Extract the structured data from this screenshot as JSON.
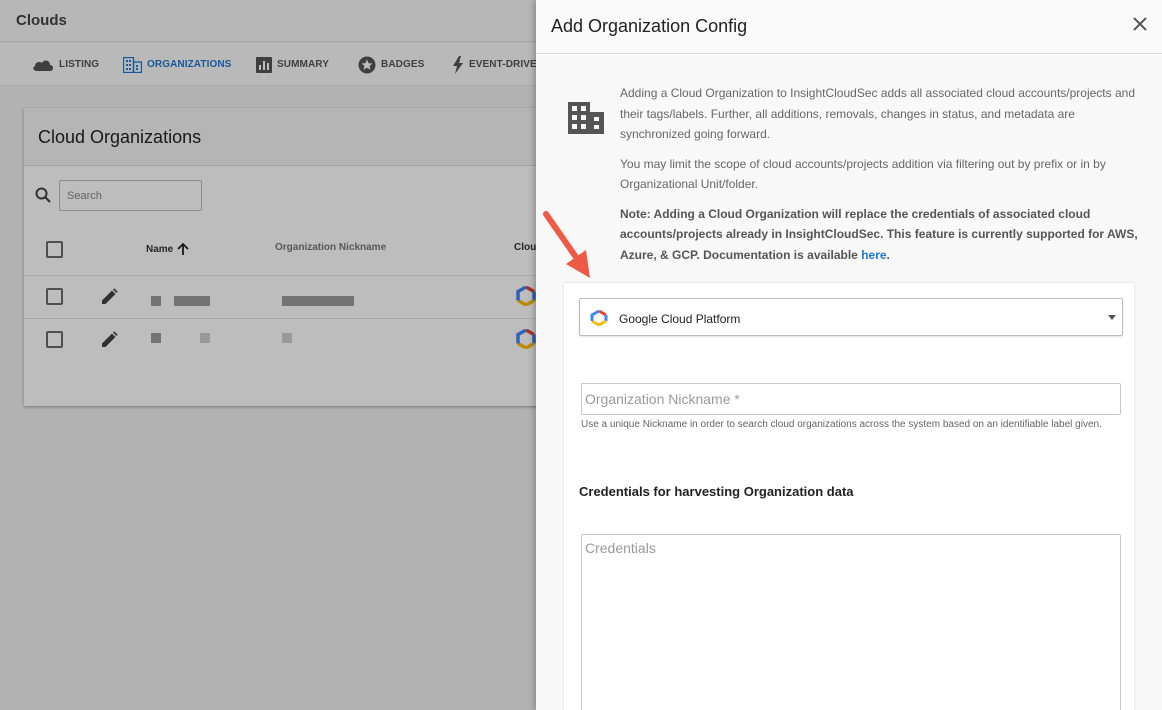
{
  "app": {
    "title": "Clouds"
  },
  "tabs": [
    {
      "label": "LISTING",
      "icon": "cloud-icon"
    },
    {
      "label": "ORGANIZATIONS",
      "icon": "building-icon",
      "active": true
    },
    {
      "label": "SUMMARY",
      "icon": "bar-chart-icon"
    },
    {
      "label": "BADGES",
      "icon": "star-badge-icon"
    },
    {
      "label": "EVENT-DRIVE",
      "icon": "lightning-icon"
    }
  ],
  "card": {
    "title": "Cloud Organizations",
    "search_placeholder": "Search",
    "columns": {
      "name": "Name",
      "nickname": "Organization Nickname",
      "cloud": "Clou"
    },
    "rows": [
      {
        "name_redacted": true,
        "nickname_redacted": true,
        "cloud_icon": "gcp-icon"
      },
      {
        "name_redacted": true,
        "nickname_redacted": true,
        "cloud_icon": "gcp-icon"
      }
    ]
  },
  "drawer": {
    "title": "Add Organization Config",
    "info_p1": "Adding a Cloud Organization to InsightCloudSec adds all associated cloud accounts/projects and their tags/labels. Further, all additions, removals, changes in status, and metadata are synchronized going forward.",
    "info_p2": "You may limit the scope of cloud accounts/projects addition via filtering out by prefix or in by Organizational Unit/folder.",
    "note_text": "Note: Adding a Cloud Organization will replace the credentials of associated cloud accounts/projects already in InsightCloudSec. This feature is currently supported for AWS, Azure, & GCP. Documentation is available ",
    "note_link": "here",
    "note_end": ".",
    "provider_selected": "Google Cloud Platform",
    "nickname_placeholder": "Organization Nickname *",
    "nickname_value": "",
    "nickname_helper": "Use a unique Nickname in order to search cloud organizations across the system based on an identifiable label given.",
    "credentials_heading": "Credentials for harvesting Organization data",
    "credentials_placeholder": "Credentials",
    "credentials_value": ""
  },
  "colors": {
    "accent": "#1f77d0",
    "annotation_arrow": "#ef5a45"
  }
}
